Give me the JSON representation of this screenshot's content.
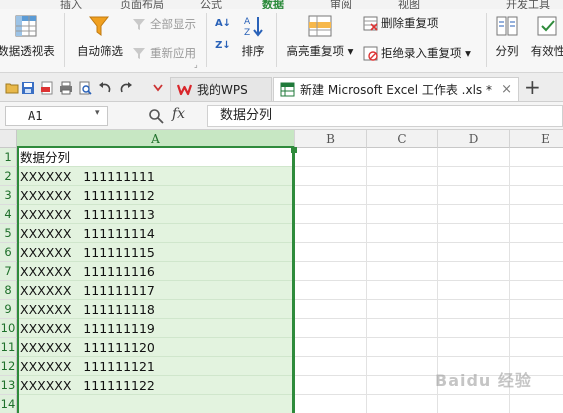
{
  "ribbon": {
    "buttons": {
      "pivot_table": "数据透视表",
      "auto_filter": "自动筛选",
      "show_all": "全部显示",
      "reapply": "重新应用",
      "sort": "排序",
      "highlight_duplicates": "高亮重复项",
      "remove_duplicates": "删除重复项",
      "reject_duplicates": "拒绝录入重复项",
      "text_to_columns": "分列",
      "validation": "有效性"
    }
  },
  "tabs": {
    "wps": "我的WPS",
    "excel": "新建 Microsoft Excel 工作表 .xls *",
    "close_symbol": "×",
    "add_symbol": "+"
  },
  "formula_bar": {
    "name_box": "A1",
    "fx": "fx",
    "content": "数据分列"
  },
  "grid": {
    "columns": [
      "A",
      "B",
      "C",
      "D",
      "E"
    ],
    "rows": [
      {
        "num": "1",
        "a": "数据分列"
      },
      {
        "num": "2",
        "a": "XXXXXX   111111111"
      },
      {
        "num": "3",
        "a": "XXXXXX   111111112"
      },
      {
        "num": "4",
        "a": "XXXXXX   111111113"
      },
      {
        "num": "5",
        "a": "XXXXXX   111111114"
      },
      {
        "num": "6",
        "a": "XXXXXX   111111115"
      },
      {
        "num": "7",
        "a": "XXXXXX   111111116"
      },
      {
        "num": "8",
        "a": "XXXXXX   111111117"
      },
      {
        "num": "9",
        "a": "XXXXXX   111111118"
      },
      {
        "num": "10",
        "a": "XXXXXX   111111119"
      },
      {
        "num": "11",
        "a": "XXXXXX   111111120"
      },
      {
        "num": "12",
        "a": "XXXXXX   111111121"
      },
      {
        "num": "13",
        "a": "XXXXXX   111111122"
      },
      {
        "num": "14",
        "a": ""
      }
    ]
  },
  "watermark": "Baidu 经验",
  "colors": {
    "accent": "#2e8b3b",
    "selection_fill": "#e3f3df",
    "header_selected": "#c7e7c3",
    "wps_red": "#d9262b",
    "excel_green": "#1f7a3a"
  }
}
